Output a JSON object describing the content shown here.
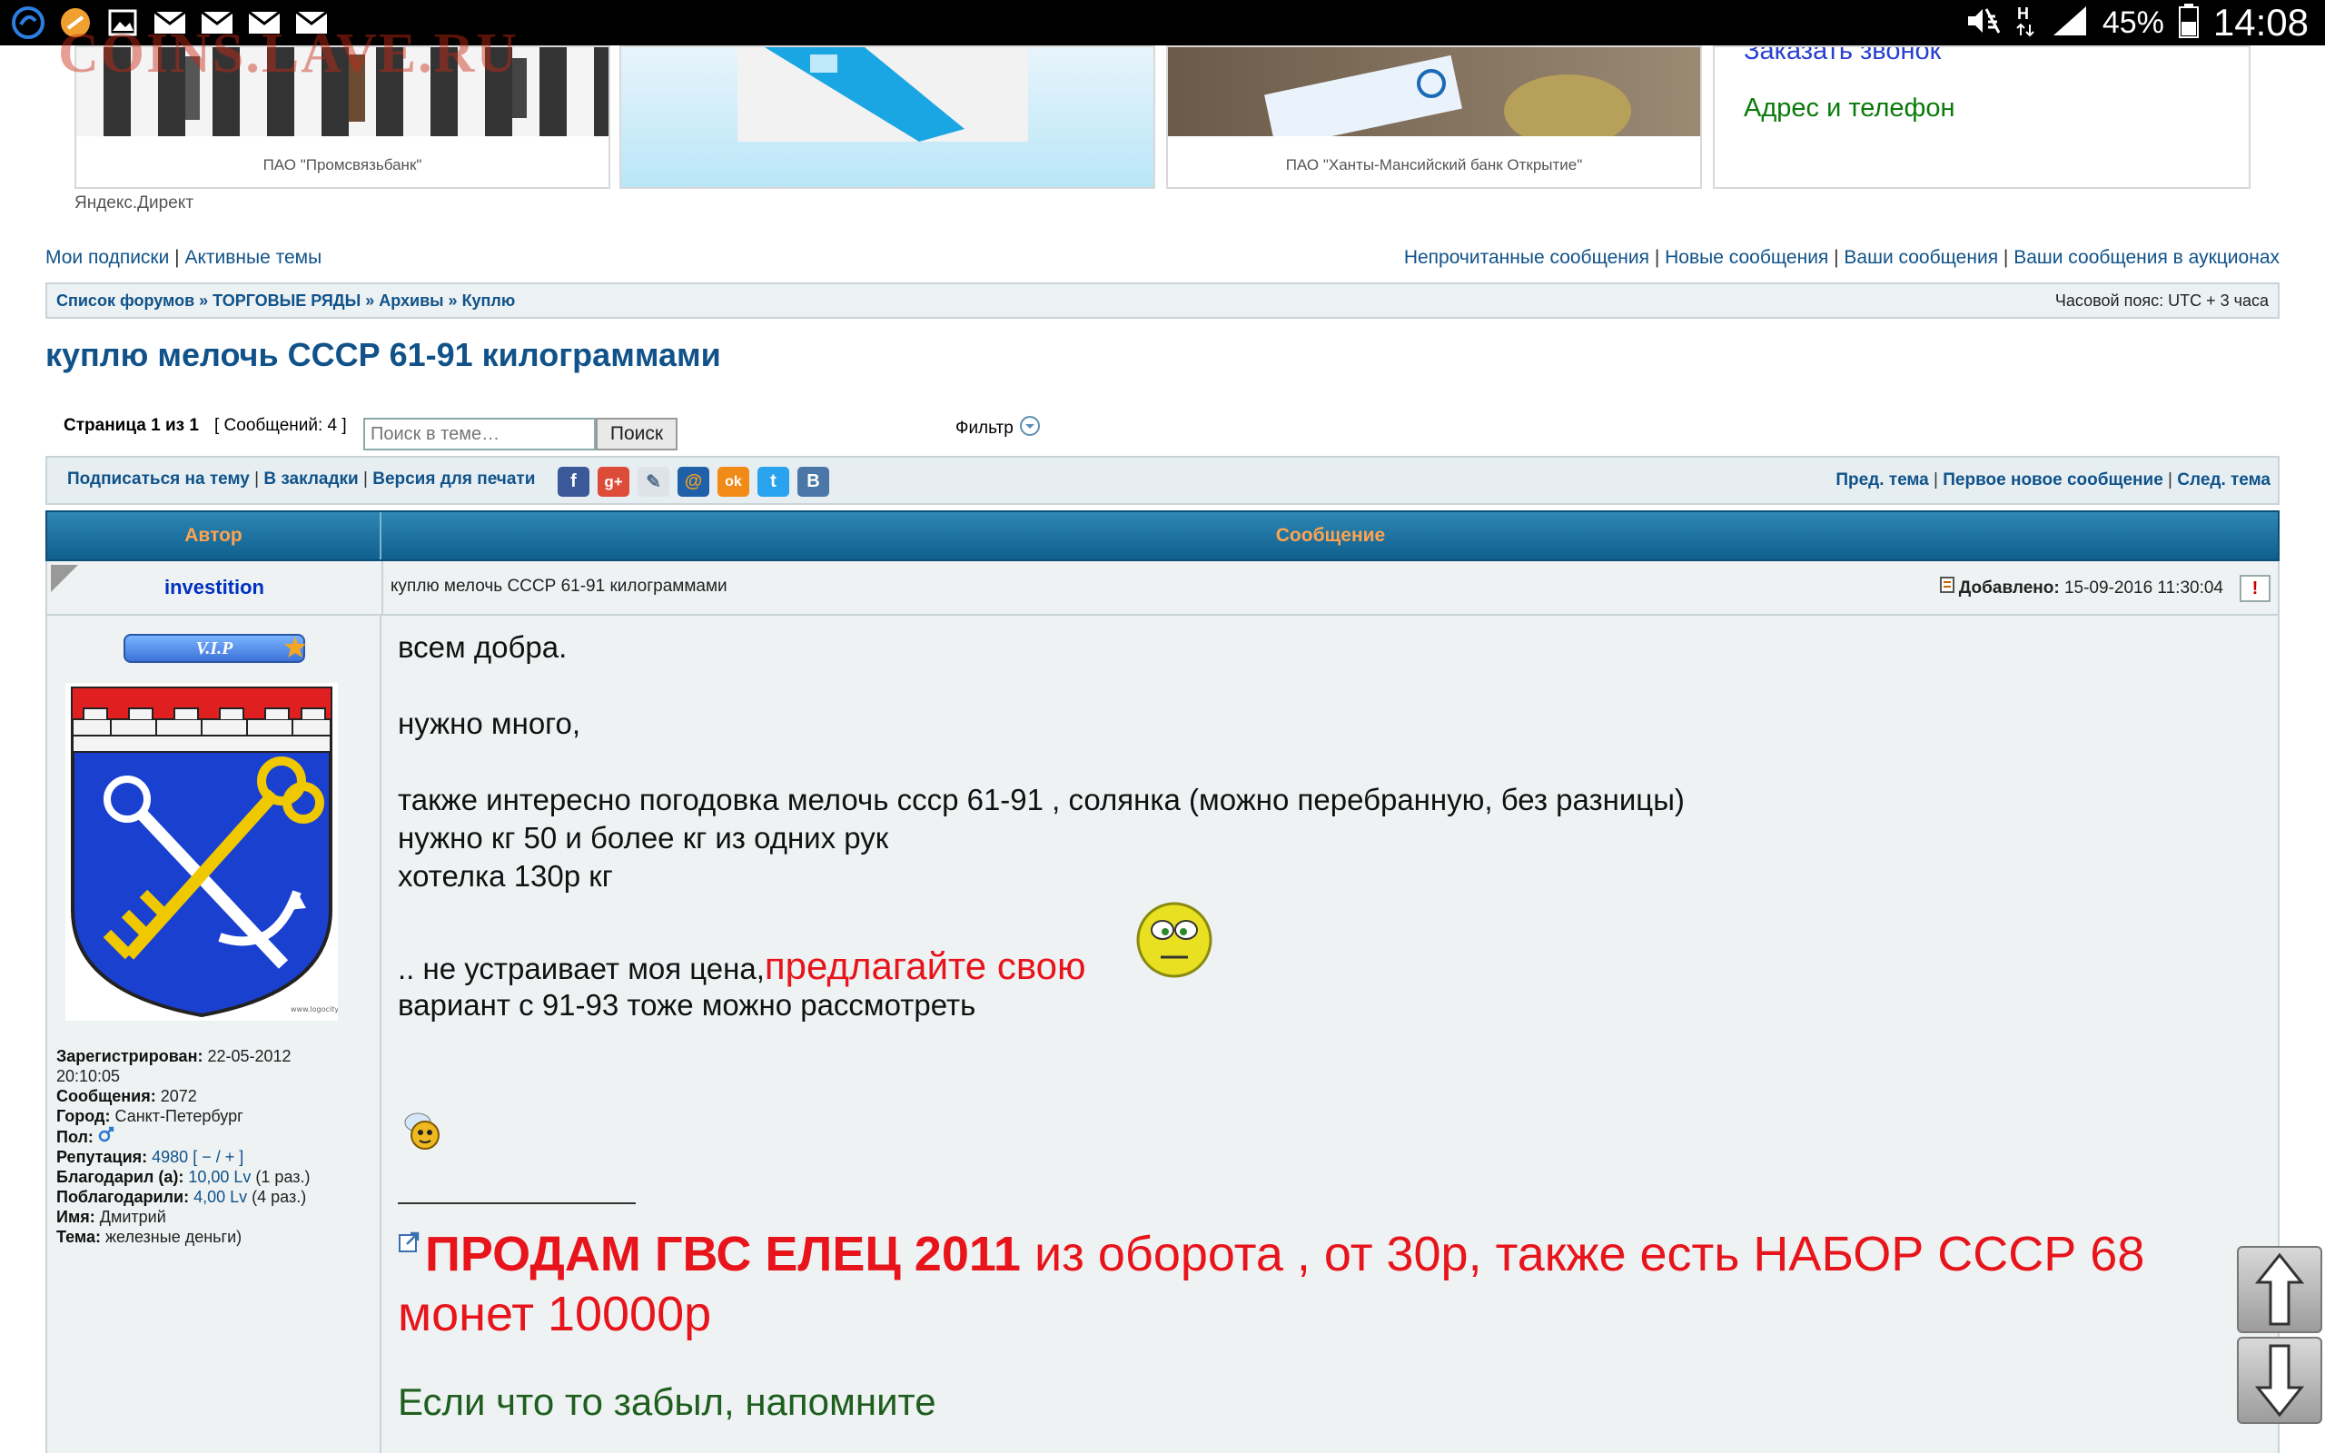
{
  "statusbar": {
    "battery": "45%",
    "time": "14:08",
    "icons": [
      "swype-icon",
      "app-icon",
      "image-icon",
      "mail-icon",
      "mail-icon",
      "mail-icon",
      "mail-icon"
    ]
  },
  "watermark": "COINS.LAVE.RU",
  "ads": {
    "card1_caption": "ПАО \"Промсвязьбанк\"",
    "card3_caption": "ПАО \"Ханты-Мансийский банк Открытие\"",
    "links": [
      "Заказать звонок",
      "Адрес и телефон"
    ],
    "yandex": "Яндекс.Директ"
  },
  "toplinks": {
    "left": [
      "Мои подписки",
      "Активные темы"
    ],
    "right": [
      "Непрочитанные сообщения",
      "Новые сообщения",
      "Ваши сообщения",
      "Ваши сообщения в аукционах"
    ]
  },
  "breadcrumb": {
    "items": [
      "Список форумов",
      "ТОРГОВЫЕ РЯДЫ",
      "Архивы",
      "Куплю"
    ],
    "timezone": "Часовой пояс: UTC + 3 часа"
  },
  "topic": {
    "title": "куплю мелочь СССР 61-91 килограммами"
  },
  "pagination": {
    "page_label": "Страница 1 из 1",
    "posts_label": "[ Сообщений: 4 ]",
    "search_placeholder": "Поиск в теме…",
    "search_button": "Поиск",
    "filter": "Фильтр"
  },
  "actions": {
    "left": [
      "Подписаться на тему",
      "В закладки",
      "Версия для печати"
    ],
    "right": [
      "Пред. тема",
      "Первое новое сообщение",
      "След. тема"
    ],
    "share": [
      {
        "glyph": "f",
        "color": "#3b5998"
      },
      {
        "glyph": "g+",
        "color": "#dd4b39"
      },
      {
        "glyph": "✎",
        "color": "#8a9aa5"
      },
      {
        "glyph": "@",
        "color": "#f0a020"
      },
      {
        "glyph": "ok",
        "color": "#f28a17"
      },
      {
        "glyph": "t",
        "color": "#2aa3ef"
      },
      {
        "glyph": "B",
        "color": "#4a76a8"
      }
    ]
  },
  "table": {
    "col_author": "Автор",
    "col_message": "Сообщение"
  },
  "post": {
    "author": "investition",
    "subject": "куплю мелочь СССР 61-91 килограммами",
    "added_label": "Добавлено:",
    "added_value": "15-09-2016 11:30:04",
    "vip": "V.I.P",
    "profile": {
      "registered_label": "Зарегистрирован:",
      "registered_value": "22-05-2012",
      "registered_time": "20:10:05",
      "posts_label": "Сообщения:",
      "posts_value": "2072",
      "city_label": "Город:",
      "city_value": "Санкт-Петербург",
      "gender_label": "Пол:",
      "reputation_label": "Репутация:",
      "reputation_value": "4980",
      "reputation_controls": "[ − / + ]",
      "thanked_label": "Благодарил (а):",
      "thanked_value": "10,00 Lv",
      "thanked_count": "(1 раз.)",
      "thanks_label": "Поблагодарили:",
      "thanks_value": "4,00 Lv",
      "thanks_count": "(4 раз.)",
      "name_label": "Имя:",
      "name_value": "Дмитрий",
      "theme_label": "Тема:",
      "theme_value": "железные деньги)"
    },
    "body": {
      "line1": "всем добра.",
      "line2": "нужно много,",
      "line3": "также интересно погодовка мелочь ссср 61-91 , солянка (можно перебранную, без разницы)",
      "line4": "нужно кг 50 и более кг из одних рук",
      "line5": "хотелка 130р кг",
      "line6_a": ".. не устраивает моя цена,",
      "line6_b": "предлагайте свою",
      "line7": "вариант с 91-93 тоже можно рассмотреть"
    },
    "signature": {
      "bold": "ПРОДАМ ГВС ЕЛЕЦ 2011",
      "rest": " из оборота , от 30р, также есть НАБОР СССР 68",
      "line2": "монет 10000р",
      "green": "Если что то забыл, напомните"
    }
  }
}
